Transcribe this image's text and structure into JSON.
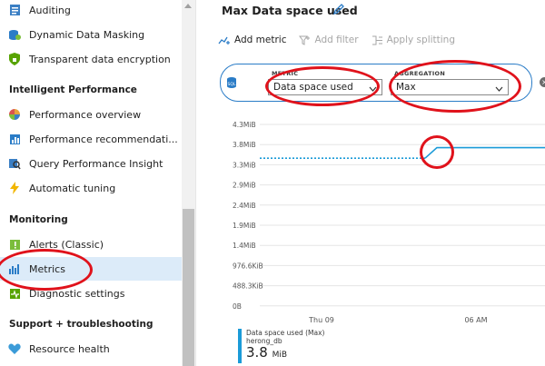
{
  "sidebar": {
    "items_top": [
      {
        "label": "Auditing",
        "icon": "auditing-icon"
      },
      {
        "label": "Dynamic Data Masking",
        "icon": "data-masking-icon"
      },
      {
        "label": "Transparent data encryption",
        "icon": "encryption-shield-icon"
      }
    ],
    "section_performance": "Intelligent Performance",
    "items_performance": [
      {
        "label": "Performance overview",
        "icon": "performance-overview-icon"
      },
      {
        "label": "Performance recommendati...",
        "icon": "recommendations-icon"
      },
      {
        "label": "Query Performance Insight",
        "icon": "query-insight-icon"
      },
      {
        "label": "Automatic tuning",
        "icon": "lightning-icon"
      }
    ],
    "section_monitoring": "Monitoring",
    "items_monitoring": [
      {
        "label": "Alerts (Classic)",
        "icon": "alerts-icon"
      },
      {
        "label": "Metrics",
        "icon": "metrics-icon",
        "selected": true
      },
      {
        "label": "Diagnostic settings",
        "icon": "diagnostic-icon"
      }
    ],
    "section_support": "Support + troubleshooting",
    "items_support": [
      {
        "label": "Resource health",
        "icon": "heart-icon"
      }
    ]
  },
  "header": {
    "title": "Max Data space used"
  },
  "toolbar": {
    "add_metric": "Add metric",
    "add_filter": "Add filter",
    "apply_splitting": "Apply splitting"
  },
  "metric_selector": {
    "metric_label": "METRIC",
    "metric_value": "Data space used",
    "aggregation_label": "AGGREGATION",
    "aggregation_value": "Max"
  },
  "colors": {
    "accent": "#2a7cc7",
    "series": "#1b9bd8",
    "annotation": "#e0121b"
  },
  "chart_data": {
    "type": "line",
    "y_ticks": [
      "4.3MiB",
      "3.8MiB",
      "3.3MiB",
      "2.9MiB",
      "2.4MiB",
      "1.9MiB",
      "1.4MiB",
      "976.6KiB",
      "488.3KiB",
      "0B"
    ],
    "x_ticks": [
      "Thu 09",
      "06 AM"
    ],
    "series": [
      {
        "name": "Data space used (Max)",
        "segment": "dotted",
        "values": [
          3.5,
          3.5,
          3.5,
          3.5
        ]
      },
      {
        "name": "Data space used (Max)",
        "segment": "solid",
        "values": [
          3.5,
          3.75,
          3.75,
          3.75,
          3.75
        ]
      }
    ],
    "legend": {
      "name": "Data space used (Max)",
      "resource": "herong_db",
      "value": "3.8",
      "unit": "MiB"
    }
  }
}
